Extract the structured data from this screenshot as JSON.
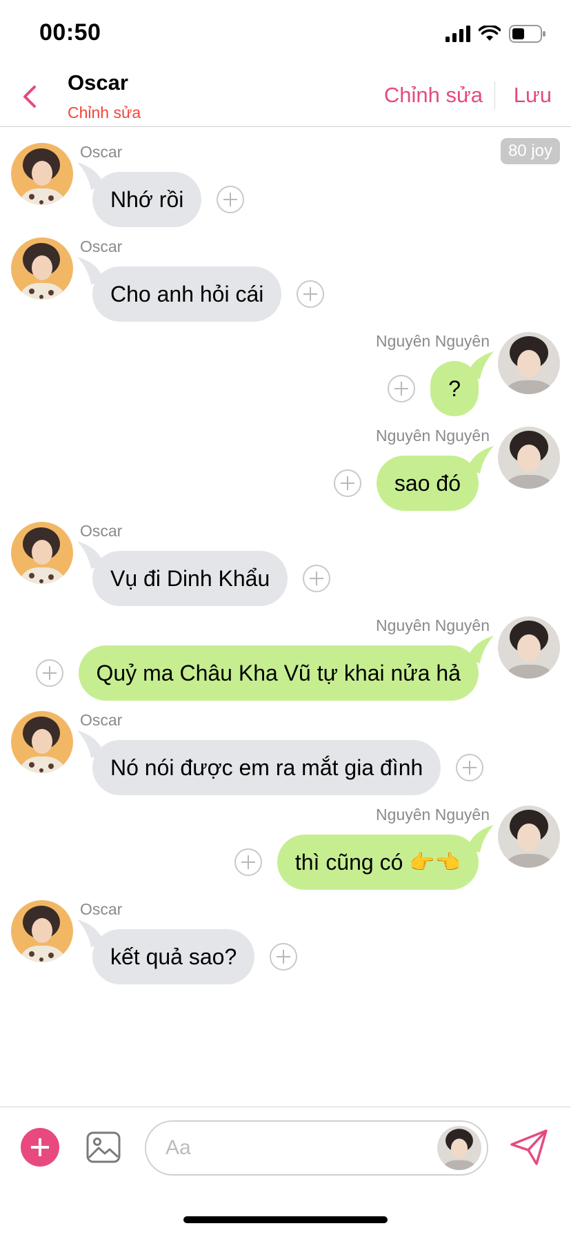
{
  "status_bar": {
    "time": "00:50"
  },
  "header": {
    "title": "Oscar",
    "subtitle": "Chỉnh sửa",
    "edit_label": "Chỉnh sửa",
    "save_label": "Lưu"
  },
  "joy_badge": "80 joy",
  "messages": [
    {
      "sender": "Oscar",
      "text": "Nhớ rồi",
      "direction": "in"
    },
    {
      "sender": "Oscar",
      "text": "Cho anh hỏi cái",
      "direction": "in"
    },
    {
      "sender": "Nguyên Nguyên",
      "text": "?",
      "direction": "out"
    },
    {
      "sender": "Nguyên Nguyên",
      "text": "sao đó",
      "direction": "out"
    },
    {
      "sender": "Oscar",
      "text": "Vụ đi Dinh Khẩu",
      "direction": "in"
    },
    {
      "sender": "Nguyên Nguyên",
      "text": "Quỷ ma Châu Kha Vũ tự khai nửa hả",
      "direction": "out"
    },
    {
      "sender": "Oscar",
      "text": "Nó nói được em ra mắt gia đình",
      "direction": "in"
    },
    {
      "sender": "Nguyên Nguyên",
      "text": "thì cũng có",
      "emoji": "👉👈",
      "direction": "out"
    },
    {
      "sender": "Oscar",
      "text": "kết quả sao?",
      "direction": "in"
    }
  ],
  "composer": {
    "placeholder": "Aa",
    "value": ""
  },
  "colors": {
    "accent": "#e54a82",
    "subtitle_red": "#f0463a",
    "incoming_bubble": "#e3e5e9",
    "outgoing_bubble": "#c6ee91"
  },
  "icons": {
    "back": "chevron-left-icon",
    "add": "plus-icon",
    "image": "image-icon",
    "send": "send-icon",
    "message_action": "plus-circle-icon"
  }
}
